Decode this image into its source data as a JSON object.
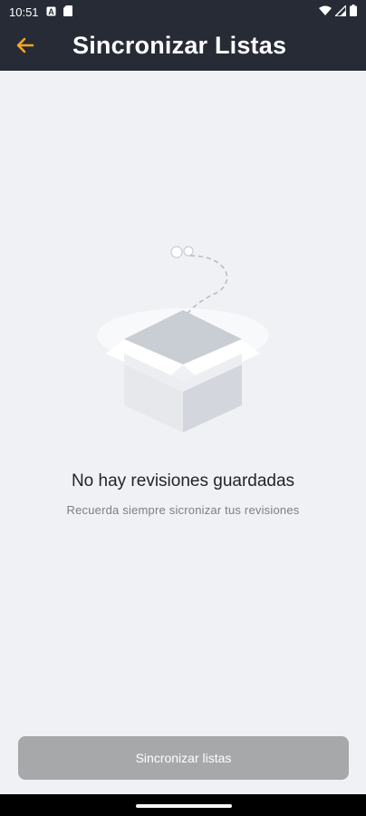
{
  "status_bar": {
    "time": "10:51",
    "left_icons": [
      "notification-a-icon",
      "sim-card-icon"
    ],
    "right_icons": [
      "wifi-icon",
      "signal-icon",
      "battery-icon"
    ]
  },
  "app_bar": {
    "title": "Sincronizar Listas",
    "back_icon": "arrow-left-icon",
    "accent_color": "#f5a623",
    "background_color": "#262b35"
  },
  "empty_state": {
    "illustration": "open-box-icon",
    "title": "No hay revisiones guardadas",
    "subtitle": "Recuerda siempre sicronizar tus revisiones"
  },
  "footer": {
    "sync_button_label": "Sincronizar listas",
    "button_color": "#a7a8aa"
  }
}
